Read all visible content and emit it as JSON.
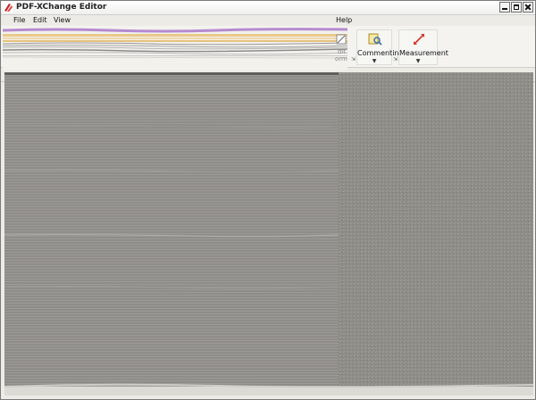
{
  "window": {
    "title": "PDF-XChange Editor"
  },
  "menu": {
    "file": "File",
    "edit": "Edit",
    "view": "View",
    "help": "Help"
  },
  "ribbon": {
    "edit_fragment": "dit",
    "form_fragment": "orm",
    "commenting": "Commenting",
    "measurement": "Measurement",
    "launcher_glyph": "⇲"
  },
  "colors": {
    "accent": "#d23b2f",
    "title_bg": "#ffffff",
    "doc_bg": "#8e8c88"
  }
}
